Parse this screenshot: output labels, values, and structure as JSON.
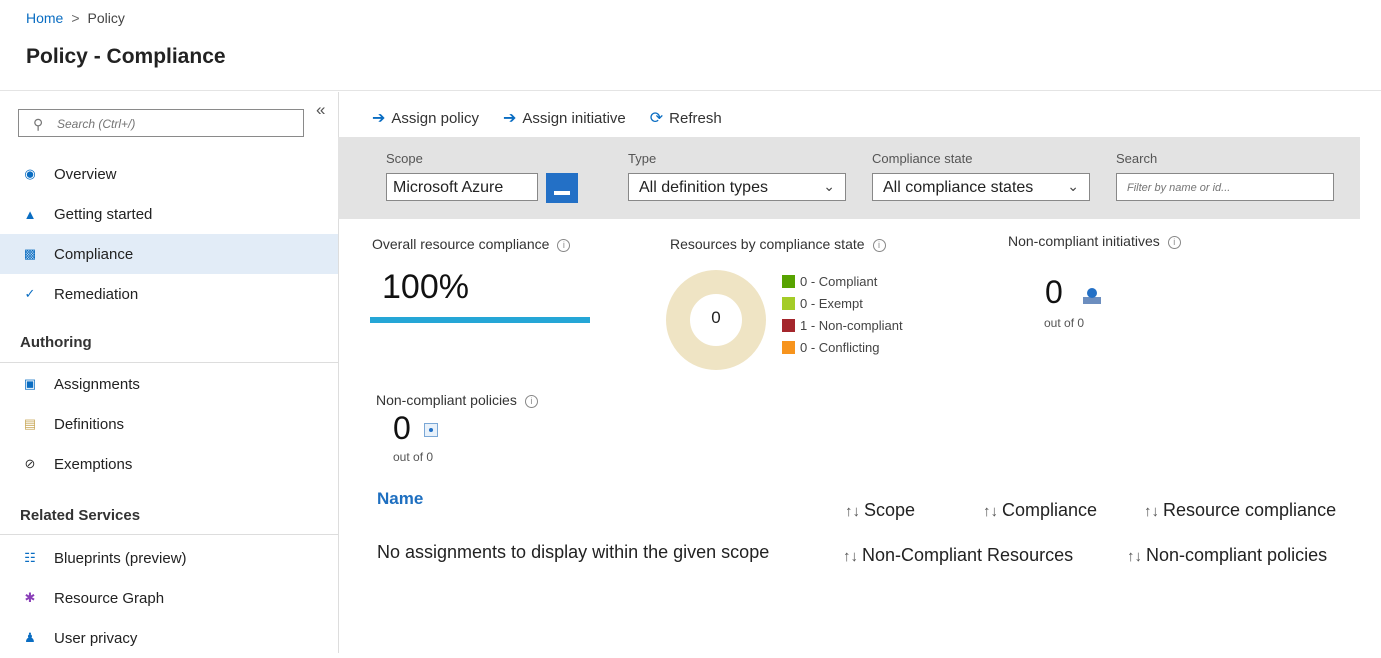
{
  "breadcrumb": {
    "home": "Home",
    "separator": ">",
    "current": "Policy"
  },
  "page": {
    "title": "Policy - Compliance"
  },
  "sidebar": {
    "search_placeholder": "Search (Ctrl+/)",
    "collapse_glyph": "«",
    "items": [
      {
        "label": "Overview",
        "icon": "overview-icon",
        "selected": false
      },
      {
        "label": "Getting started",
        "icon": "getting-started-icon",
        "selected": false
      },
      {
        "label": "Compliance",
        "icon": "compliance-icon",
        "selected": true
      },
      {
        "label": "Remediation",
        "icon": "remediation-icon",
        "selected": false
      }
    ],
    "authoring": {
      "heading": "Authoring",
      "items": [
        {
          "label": "Assignments",
          "icon": "assignments-icon"
        },
        {
          "label": "Definitions",
          "icon": "definitions-icon"
        },
        {
          "label": "Exemptions",
          "icon": "exemptions-icon"
        }
      ]
    },
    "related": {
      "heading": "Related Services",
      "items": [
        {
          "label": "Blueprints (preview)",
          "icon": "blueprints-icon"
        },
        {
          "label": "Resource Graph",
          "icon": "resource-graph-icon"
        },
        {
          "label": "User privacy",
          "icon": "user-privacy-icon"
        }
      ]
    }
  },
  "toolbar": {
    "assign_policy": "Assign policy",
    "assign_initiative": "Assign initiative",
    "refresh": "Refresh"
  },
  "filters": {
    "scope": {
      "label": "Scope",
      "value": "Microsoft Azure"
    },
    "type": {
      "label": "Type",
      "value": "All definition types"
    },
    "compliance_state": {
      "label": "Compliance state",
      "value": "All compliance states"
    },
    "search": {
      "label": "Search",
      "placeholder": "Filter by name or id..."
    }
  },
  "overall": {
    "label": "Overall resource compliance",
    "value": "100%",
    "progress": 1.0
  },
  "resources_by_state": {
    "label": "Resources by compliance state",
    "total": "0",
    "legend": [
      {
        "label": "0 - Compliant",
        "color": "#57a300"
      },
      {
        "label": "0 - Exempt",
        "color": "#a4cc27"
      },
      {
        "label": "1 - Non-compliant",
        "color": "#a4262c"
      },
      {
        "label": "0 - Conflicting",
        "color": "#f7941d"
      }
    ]
  },
  "noncompliant_initiatives": {
    "label": "Non-compliant initiatives",
    "count": "0",
    "out_of": "out of 0"
  },
  "noncompliant_policies": {
    "label": "Non-compliant policies",
    "count": "0",
    "out_of": "out of 0"
  },
  "table": {
    "columns": {
      "name": "Name",
      "scope": "Scope",
      "compliance": "Compliance",
      "resource_compliance": "Resource compliance",
      "noncompliant_resources": "Non-Compliant Resources",
      "noncompliant_policies": "Non-compliant policies"
    },
    "sort_glyph": "↑↓",
    "empty_message": "No assignments to display within the given scope"
  },
  "colors": {
    "accent": "#0a6dc2",
    "progress": "#25a6d6",
    "donut_empty": "#efe4c4"
  }
}
